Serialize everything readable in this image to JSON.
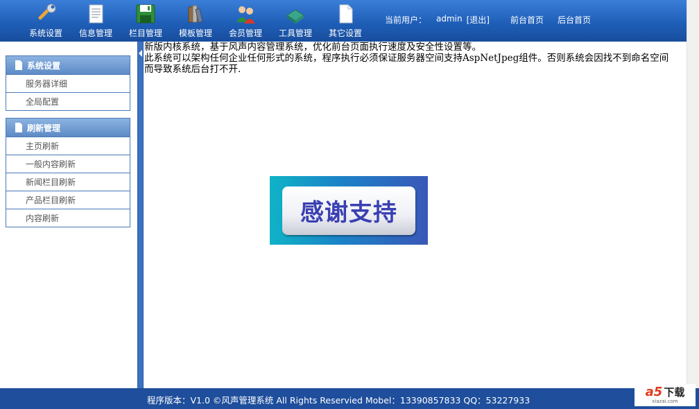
{
  "nav": {
    "items": [
      {
        "label": "系统设置",
        "icon": "wrench-icon"
      },
      {
        "label": "信息管理",
        "icon": "document-icon"
      },
      {
        "label": "栏目管理",
        "icon": "save-disk-icon"
      },
      {
        "label": "模板管理",
        "icon": "books-icon"
      },
      {
        "label": "会员管理",
        "icon": "users-icon"
      },
      {
        "label": "工具管理",
        "icon": "toolbox-icon"
      },
      {
        "label": "其它设置",
        "icon": "blank-page-icon"
      }
    ]
  },
  "userbar": {
    "current_user_label": "当前用户：",
    "username": "admin",
    "logout": "[退出]",
    "front_home": "前台首页",
    "back_home": "后台首页"
  },
  "sidebar": {
    "menus": [
      {
        "title": "系统设置",
        "items": [
          "服务器详细",
          "全局配置"
        ]
      },
      {
        "title": "刷新管理",
        "items": [
          "主页刷新",
          "一般内容刷新",
          "新闻栏目刷新",
          "产品栏目刷新",
          "内容刷新"
        ]
      }
    ]
  },
  "content": {
    "line1": "新版内核系统，基于风声内容管理系统，优化前台页面执行速度及安全性设置等。",
    "line2": "此系统可以架构任何企业任何形式的系统，程序执行必须保证服务器空间支持AspNetJpeg组件。否则系统会因找不到命名空间而导致系统后台打不开.",
    "banner_text": "感谢支持"
  },
  "footer": {
    "text": "程序版本：V1.0 ©风声管理系统  All Rights Reservied   Mobel：13390857833   QQ：53227933"
  },
  "watermark": {
    "logo": "a5",
    "cn": "下载",
    "sub": "xiazai.com"
  },
  "colors": {
    "topbar": "#1f5fb8",
    "sidebar_border": "#4a79b8",
    "footer": "#1e4e9c",
    "banner_text": "#3a3fb2"
  }
}
